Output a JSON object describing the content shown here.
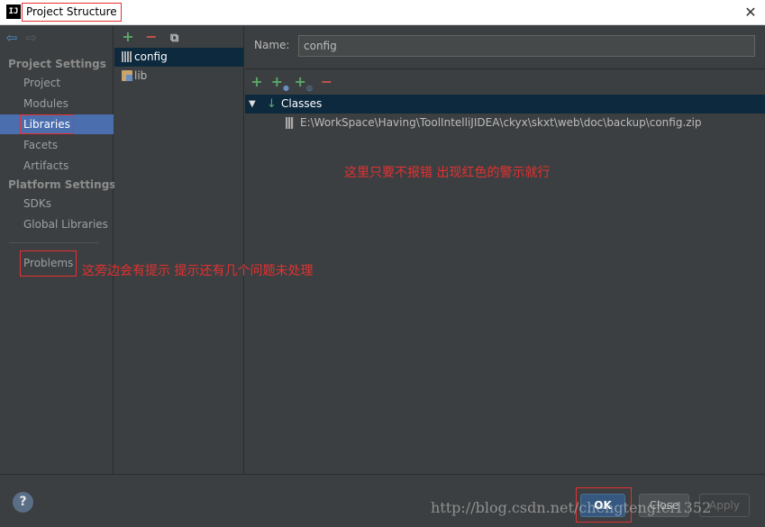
{
  "window": {
    "app_icon_text": "IJ",
    "title": "Project Structure",
    "close_glyph": "✕"
  },
  "sidebar": {
    "back_glyph": "⇦",
    "forward_glyph": "⇨",
    "project_settings_header": "Project Settings",
    "project_items": [
      "Project",
      "Modules",
      "Libraries",
      "Facets",
      "Artifacts"
    ],
    "platform_settings_header": "Platform Settings",
    "platform_items": [
      "SDKs",
      "Global Libraries"
    ],
    "selected_item": "Libraries",
    "problems_label": "Problems"
  },
  "libraries_toolbar": {
    "add_glyph": "+",
    "remove_glyph": "−",
    "copy_glyph": "⧉"
  },
  "libraries": [
    {
      "name": "config",
      "icon": "library-bars-icon",
      "selected": true
    },
    {
      "name": "lib",
      "icon": "library-folder-icon",
      "selected": false
    }
  ],
  "detail": {
    "name_label": "Name:",
    "name_value": "config",
    "toolbar": {
      "add_glyph": "+",
      "add_classes_glyph": "+",
      "add_dir_glyph": "+",
      "remove_glyph": "−"
    },
    "tree": {
      "expand_glyph": "▼",
      "classes_icon_glyph": "↓",
      "classes_label": "Classes",
      "path": "E:\\WorkSpace\\Having\\ToolIntelliJIDEA\\ckyx\\skxt\\web\\doc\\backup\\config.zip"
    }
  },
  "annotations": {
    "center_note": "这里只要不报错  出现红色的警示就行",
    "problems_note": "这旁边会有提示  提示还有几个问题未处理"
  },
  "footer": {
    "help_glyph": "?",
    "ok_label": "OK",
    "close_label": "Close",
    "apply_label": "Apply",
    "watermark": "http://blog.csdn.net/chengtengfei1352"
  },
  "colors": {
    "background": "#3c3f41",
    "selection": "#4b6eaf",
    "tree_selection": "#0d293e",
    "annotation_red": "#e53030",
    "add_green": "#59a869",
    "remove_red": "#c75450",
    "ok_blue": "#365880"
  }
}
